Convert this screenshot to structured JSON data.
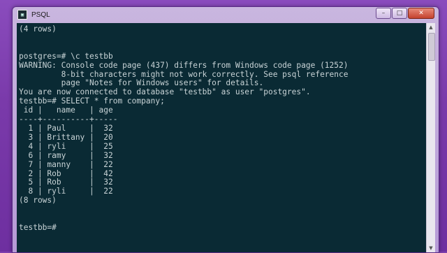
{
  "window": {
    "title": "PSQL",
    "app_icon": "terminal-icon",
    "icon_glyph": "▣",
    "minimize_glyph": "–",
    "maximize_glyph": "□",
    "close_glyph": "✕"
  },
  "console": {
    "lines": [
      "(4 rows)",
      "",
      "",
      "postgres=# \\c testbb",
      "WARNING: Console code page (437) differs from Windows code page (1252)",
      "         8-bit characters might not work correctly. See psql reference",
      "         page \"Notes for Windows users\" for details.",
      "You are now connected to database \"testbb\" as user \"postgres\".",
      "testbb=# SELECT * from company;",
      " id |   name   | age",
      "----+----------+-----",
      "  1 | Paul     |  32",
      "  3 | Brittany |  20",
      "  4 | ryli     |  25",
      "  6 | ramy     |  32",
      "  7 | manny    |  22",
      "  2 | Rob      |  42",
      "  5 | Rob      |  32",
      "  8 | ryli     |  22",
      "(8 rows)",
      "",
      "",
      "testbb=#"
    ]
  },
  "scrollbar": {
    "up_glyph": "▲",
    "down_glyph": "▼"
  },
  "colors": {
    "console_bg": "#0a2a34",
    "console_fg": "#c8d3d6",
    "desktop_bg": "#7d3fae"
  }
}
